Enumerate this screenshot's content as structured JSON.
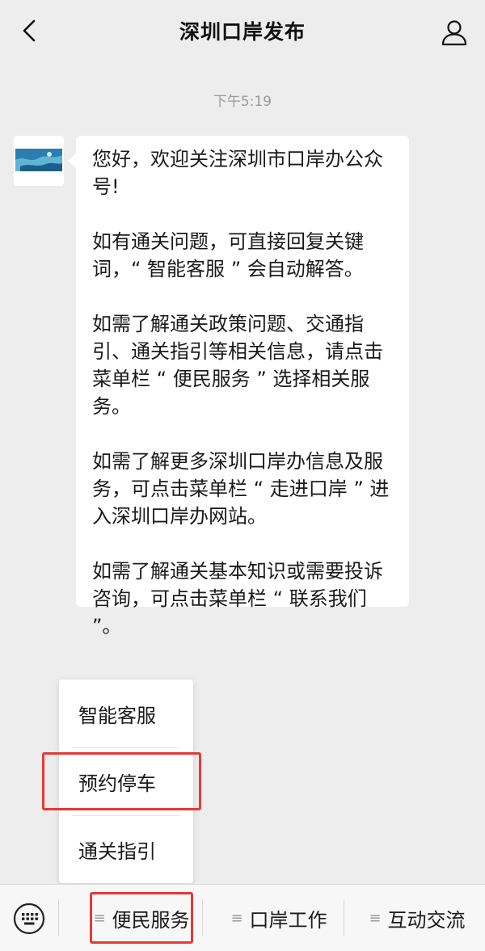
{
  "header": {
    "title": "深圳口岸发布",
    "back_icon": "chevron-left-icon",
    "profile_icon": "person-icon"
  },
  "chat": {
    "timestamp": "下午5:19",
    "message": {
      "paragraphs": [
        "您好，欢迎关注深圳市口岸办公众号!",
        "如有通关问题，可直接回复关键词，“ 智能客服 ” 会自动解答。",
        "如需了解通关政策问题、交通指引、通关指引等相关信息，请点击菜单栏 “ 便民服务 ” 选择相关服务。",
        "如需了解更多深圳口岸办信息及服务，可点击菜单栏 “ 走进口岸 ” 进入深圳口岸办网站。",
        "如需了解通关基本知识或需要投诉咨询，可点击菜单栏 “ 联系我们 ”。"
      ]
    }
  },
  "popup_menu": {
    "items": [
      "智能客服",
      "预约停车",
      "通关指引"
    ],
    "highlighted_index": 1
  },
  "bottom_menu": {
    "keyboard_icon": "keyboard-icon",
    "tabs": [
      "便民服务",
      "口岸工作",
      "互动交流"
    ],
    "highlighted_index": 0
  },
  "colors": {
    "background": "#ededed",
    "bubble": "#ffffff",
    "highlight": "#e53935",
    "muted_text": "#9a9a9a"
  }
}
